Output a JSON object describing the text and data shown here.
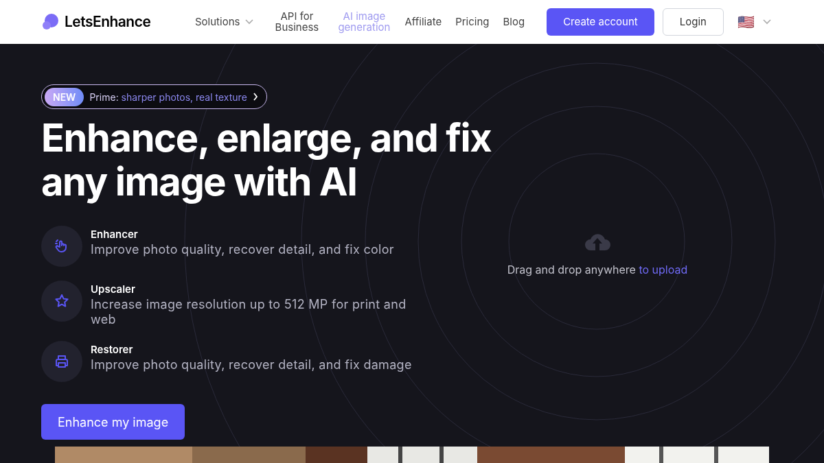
{
  "header": {
    "logo": "LetsEnhance",
    "nav": [
      {
        "label": "Solutions",
        "dropdown": true,
        "selected": false
      },
      {
        "label": "API for Business",
        "dropdown": false,
        "selected": false
      },
      {
        "label": "AI image generation",
        "dropdown": false,
        "selected": true
      },
      {
        "label": "Affiliate",
        "dropdown": false,
        "selected": false
      },
      {
        "label": "Pricing",
        "dropdown": false,
        "selected": false
      },
      {
        "label": "Blog",
        "dropdown": false,
        "selected": false
      }
    ],
    "create_account": "Create account",
    "login": "Login",
    "language_flag": "🇺🇸"
  },
  "announcement": {
    "badge": "NEW",
    "prefix": "Prime:",
    "text": "sharper photos, real texture"
  },
  "headline": "Enhance, enlarge, and fix any image with AI",
  "features": [
    {
      "kind": "hand",
      "title": "Enhancer",
      "description": "Improve photo quality, recover detail, and fix color"
    },
    {
      "kind": "star",
      "title": "Upscaler",
      "description": "Increase image resolution up to 512 MP for print and web"
    },
    {
      "kind": "printer",
      "title": "Restorer",
      "description": "Improve photo quality, recover detail, and fix damage"
    }
  ],
  "cta": "Enhance my image",
  "upload": {
    "text": "Drag and drop anywhere",
    "link": "to upload"
  }
}
